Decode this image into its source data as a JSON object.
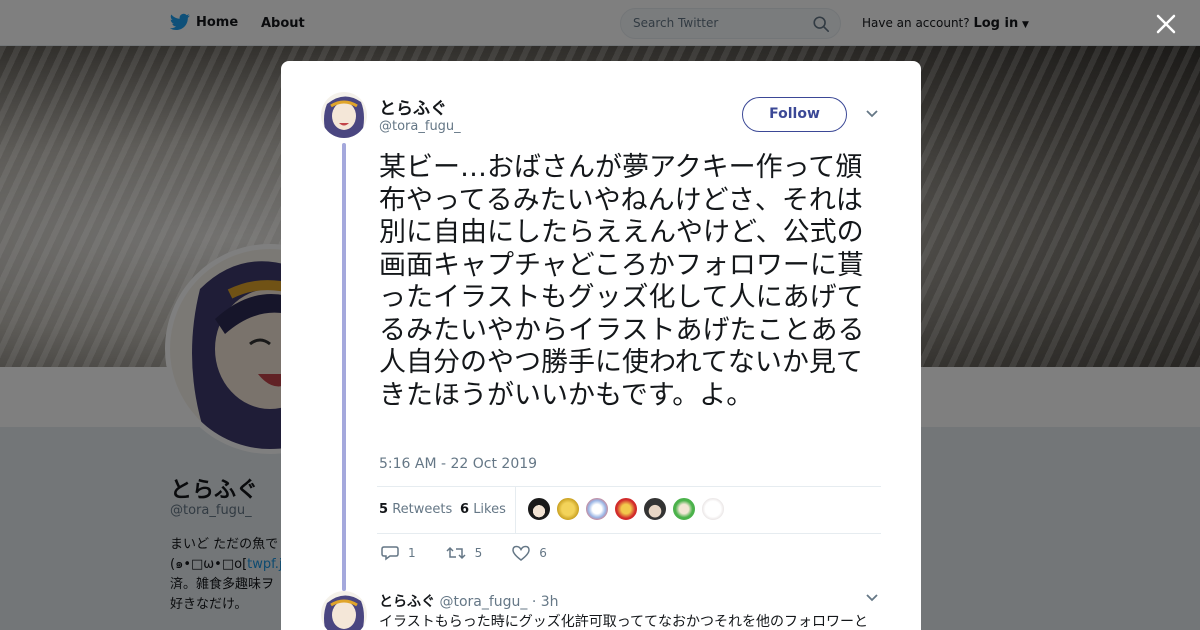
{
  "nav": {
    "home_label": "Home",
    "about_label": "About",
    "search_placeholder": "Search Twitter",
    "have_account": "Have an account?",
    "login_label": "Log in"
  },
  "profile": {
    "name": "とらふぐ",
    "handle": "@tora_fugu_",
    "bio_line1": "まいど ただの魚で",
    "bio_line2_prefix": "(๑•□ω•□o[",
    "bio_line2_link": "twpf.jp",
    "bio_line3": "済。雑食多趣味ヲ",
    "bio_line4": "好きなだけ。"
  },
  "tweet": {
    "name": "とらふぐ",
    "handle": "@tora_fugu_",
    "follow_label": "Follow",
    "text": "某ビー…おばさんが夢アクキー作って頒布やってるみたいやねんけどさ、それは別に自由にしたらええんやけど、公式の画面キャプチャどころかフォロワーに貰ったイラストもグッズ化して人にあげてるみたいやからイラストあげたことある人自分のやつ勝手に使われてないか見てきたほうがいいかもです。よ。",
    "timestamp": "5:16 AM - 22 Oct 2019",
    "retweets_count": "5",
    "retweets_label": "Retweets",
    "likes_count": "6",
    "likes_label": "Likes",
    "reply_count": "1",
    "retweet_action_count": "5",
    "like_action_count": "6"
  },
  "reply": {
    "name": "とらふぐ",
    "handle": "@tora_fugu_",
    "time": "· 3h",
    "text": "イラストもらった時にグッズ化許可取っててなおかつそれを他のフォロワーと"
  },
  "colors": {
    "accent": "#3b4896",
    "thread": "#a4a8dc",
    "twitter_blue": "#1da1f2"
  },
  "icons": {
    "brand": "twitter-bird-icon",
    "search": "search-icon",
    "close": "close-icon",
    "caret": "chevron-down-icon",
    "reply": "reply-icon",
    "retweet": "retweet-icon",
    "like": "heart-icon"
  }
}
